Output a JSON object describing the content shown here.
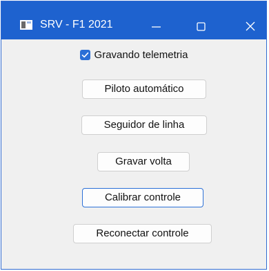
{
  "window": {
    "title": "SRV - F1 2021",
    "accent_color": "#1e62cf",
    "icon": "app-window-icon",
    "controls": {
      "minimize_icon": "minimize-icon",
      "maximize_icon": "maximize-icon",
      "close_icon": "close-icon"
    }
  },
  "telemetry": {
    "checked": true,
    "label": "Gravando telemetria"
  },
  "buttons": {
    "autopilot": "Piloto automático",
    "line_follower": "Seguidor de linha",
    "record_lap": "Gravar volta",
    "calibrate": "Calibrar controle",
    "reconnect": "Reconectar controle"
  }
}
